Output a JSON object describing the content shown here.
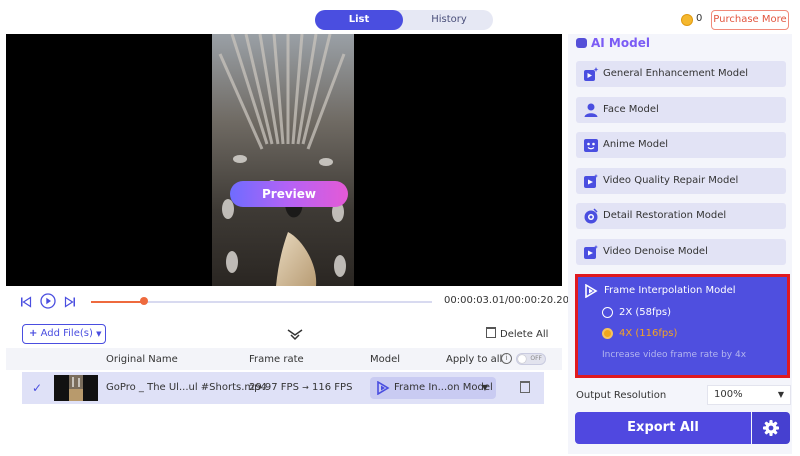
{
  "tabs": {
    "list": "List",
    "history": "History"
  },
  "account": {
    "coins": "0",
    "purchase": "Purchase More"
  },
  "player": {
    "preview": "Preview",
    "timecode": "00:00:03.01/00:00:20.20",
    "progress": 0.155
  },
  "files": {
    "add": "Add File(s)",
    "delete_all": "Delete All",
    "columns": {
      "name": "Original Name",
      "frame_rate": "Frame rate",
      "model": "Model",
      "apply_all": "Apply to all",
      "toggle": "OFF"
    },
    "rows": [
      {
        "name": "GoPro _ The Ul...ul #Shorts.mp4",
        "fps_from": "29.97 FPS",
        "arrow": "→",
        "fps_to": "116 FPS",
        "model": "Frame In...on Model"
      }
    ]
  },
  "panel": {
    "title": "AI Model",
    "models": [
      {
        "label": "General Enhancement Model",
        "icon": "enhance-icon"
      },
      {
        "label": "Face Model",
        "icon": "face-icon"
      },
      {
        "label": "Anime Model",
        "icon": "anime-icon"
      },
      {
        "label": "Video Quality Repair Model",
        "icon": "repair-icon"
      },
      {
        "label": "Detail Restoration Model",
        "icon": "detail-icon"
      },
      {
        "label": "Video Denoise Model",
        "icon": "denoise-icon"
      }
    ],
    "frame_interp": {
      "title": "Frame Interpolation Model",
      "options": [
        "2X (58fps)",
        "4X (116fps)"
      ],
      "selected": 1,
      "hint": "Increase video frame rate by 4x"
    },
    "output_label": "Output Resolution",
    "output_value": "100%",
    "export": "Export All"
  },
  "colors": {
    "accent": "#4a4ee0",
    "highlight": "#e0191f",
    "orange": "#ee6a3e"
  }
}
